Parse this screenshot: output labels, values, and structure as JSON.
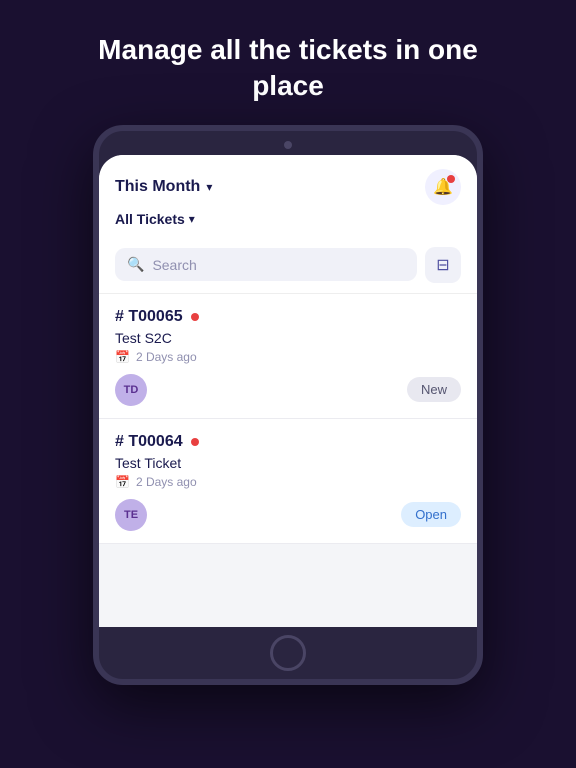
{
  "headline": {
    "text": "Manage all the tickets in one place"
  },
  "header": {
    "month_label": "This Month",
    "chevron": "▾",
    "all_tickets_label": "All Tickets",
    "notif_has_dot": true
  },
  "search": {
    "placeholder": "Search",
    "filter_icon": "≡"
  },
  "tickets": [
    {
      "id": "# T00065",
      "name": "Test S2C",
      "date": "2 Days ago",
      "assignee_initials": "TD",
      "status": "New",
      "status_type": "new"
    },
    {
      "id": "# T00064",
      "name": "Test Ticket",
      "date": "2 Days ago",
      "assignee_initials": "TE",
      "status": "Open",
      "status_type": "open"
    }
  ]
}
